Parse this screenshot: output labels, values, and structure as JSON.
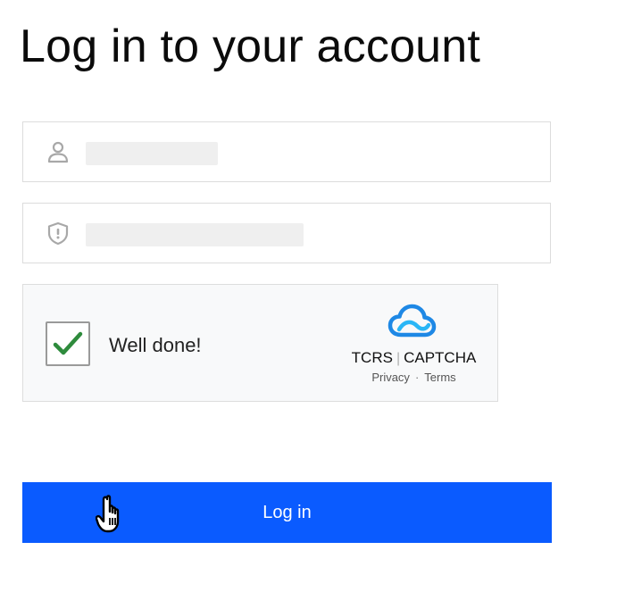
{
  "header": {
    "title": "Log in to your account"
  },
  "form": {
    "username": {
      "icon": "user-icon",
      "value": ""
    },
    "password": {
      "icon": "shield-icon",
      "value": ""
    },
    "captcha": {
      "checked": true,
      "status_text": "Well done!",
      "brand_left": "TCRS",
      "brand_right": "CAPTCHA",
      "privacy_label": "Privacy",
      "link_separator": "·",
      "terms_label": "Terms",
      "logo_icon": "cloud-icon",
      "check_color": "#2e8b3c",
      "logo_color": "#1e88e5"
    },
    "submit": {
      "label": "Log in",
      "color": "#0a5bff"
    }
  },
  "cursor": {
    "icon": "hand-pointer-icon"
  }
}
